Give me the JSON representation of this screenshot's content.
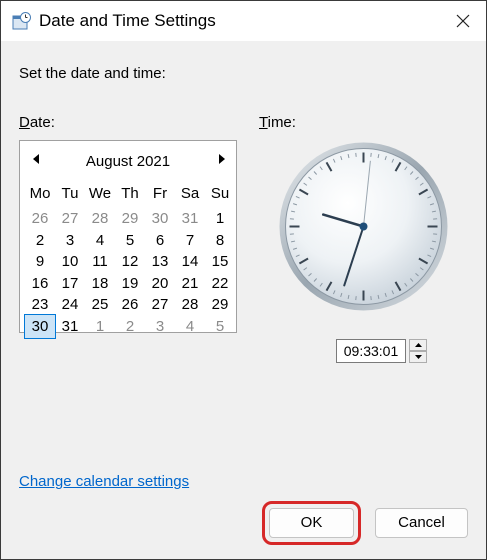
{
  "window": {
    "title": "Date and Time Settings",
    "icon": "clock-calendar-icon"
  },
  "intro_text": "Set the date and time:",
  "date_label": "Date:",
  "time_label": "Time:",
  "calendar": {
    "month_label": "August 2021",
    "days_of_week": [
      "Mo",
      "Tu",
      "We",
      "Th",
      "Fr",
      "Sa",
      "Su"
    ],
    "weeks": [
      [
        {
          "d": "26",
          "o": true
        },
        {
          "d": "27",
          "o": true
        },
        {
          "d": "28",
          "o": true
        },
        {
          "d": "29",
          "o": true
        },
        {
          "d": "30",
          "o": true
        },
        {
          "d": "31",
          "o": true
        },
        {
          "d": "1",
          "o": false
        }
      ],
      [
        {
          "d": "2",
          "o": false
        },
        {
          "d": "3",
          "o": false
        },
        {
          "d": "4",
          "o": false
        },
        {
          "d": "5",
          "o": false
        },
        {
          "d": "6",
          "o": false
        },
        {
          "d": "7",
          "o": false
        },
        {
          "d": "8",
          "o": false
        }
      ],
      [
        {
          "d": "9",
          "o": false
        },
        {
          "d": "10",
          "o": false
        },
        {
          "d": "11",
          "o": false
        },
        {
          "d": "12",
          "o": false
        },
        {
          "d": "13",
          "o": false
        },
        {
          "d": "14",
          "o": false
        },
        {
          "d": "15",
          "o": false
        }
      ],
      [
        {
          "d": "16",
          "o": false
        },
        {
          "d": "17",
          "o": false
        },
        {
          "d": "18",
          "o": false
        },
        {
          "d": "19",
          "o": false
        },
        {
          "d": "20",
          "o": false
        },
        {
          "d": "21",
          "o": false
        },
        {
          "d": "22",
          "o": false
        }
      ],
      [
        {
          "d": "23",
          "o": false
        },
        {
          "d": "24",
          "o": false
        },
        {
          "d": "25",
          "o": false
        },
        {
          "d": "26",
          "o": false
        },
        {
          "d": "27",
          "o": false
        },
        {
          "d": "28",
          "o": false
        },
        {
          "d": "29",
          "o": false
        }
      ],
      [
        {
          "d": "30",
          "o": false,
          "sel": true
        },
        {
          "d": "31",
          "o": false
        },
        {
          "d": "1",
          "o": true
        },
        {
          "d": "2",
          "o": true
        },
        {
          "d": "3",
          "o": true
        },
        {
          "d": "4",
          "o": true
        },
        {
          "d": "5",
          "o": true
        }
      ]
    ]
  },
  "time": {
    "value": "09:33:01",
    "hours": 9,
    "minutes": 33,
    "seconds": 1
  },
  "link_text": "Change calendar settings",
  "buttons": {
    "ok": "OK",
    "cancel": "Cancel"
  },
  "colors": {
    "accent": "#0078d7",
    "link": "#0066cc",
    "highlight": "#d62828"
  }
}
